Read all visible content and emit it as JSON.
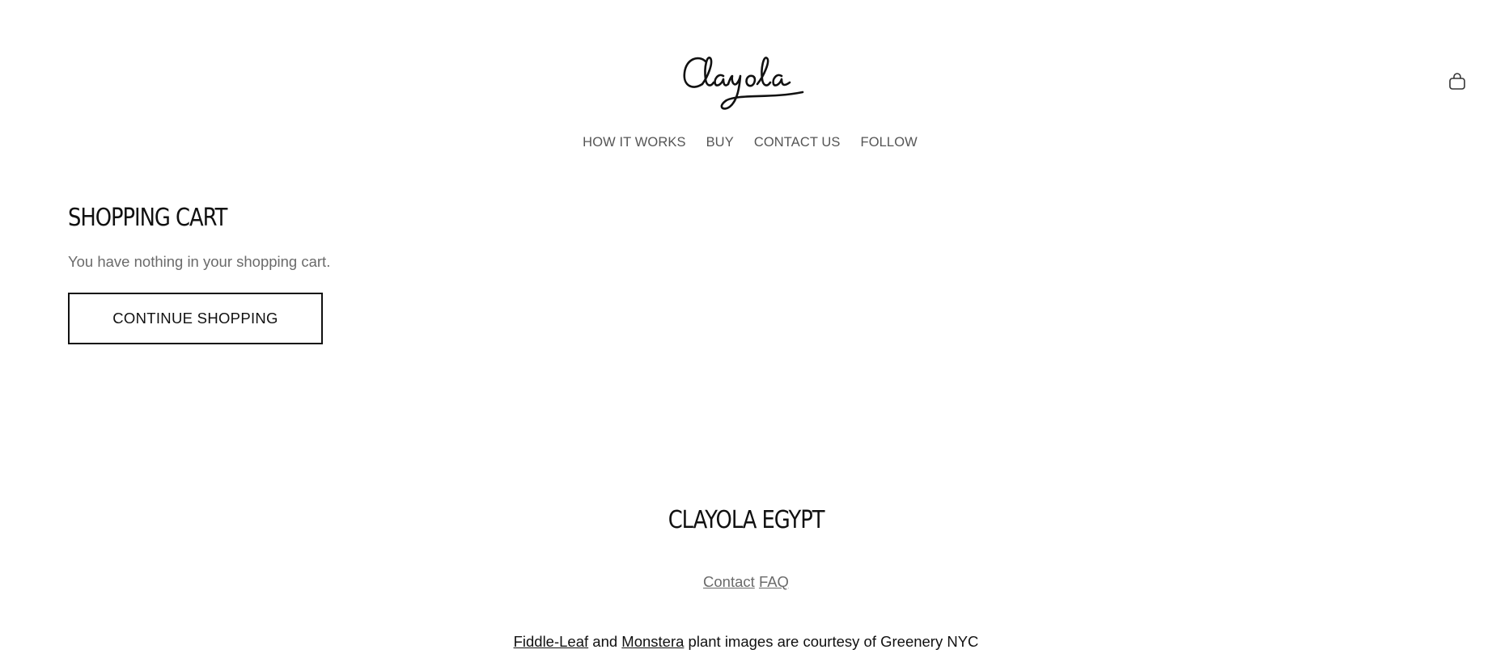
{
  "header": {
    "logo_text": "Clayola",
    "cart_icon": "shopping-bag-icon"
  },
  "nav": {
    "items": [
      {
        "label": "HOW IT WORKS"
      },
      {
        "label": "BUY"
      },
      {
        "label": "CONTACT US"
      },
      {
        "label": "FOLLOW"
      }
    ]
  },
  "cart": {
    "title": "SHOPPING CART",
    "empty_message": "You have nothing in your shopping cart.",
    "continue_label": "CONTINUE SHOPPING"
  },
  "footer": {
    "title": "CLAYOLA EGYPT",
    "links": [
      {
        "label": "Contact"
      },
      {
        "label": "FAQ"
      }
    ],
    "credits": {
      "link1": "Fiddle-Leaf",
      "and_text": " and ",
      "link2": "Monstera",
      "rest": " plant images are courtesy of Greenery NYC"
    }
  },
  "colors": {
    "text": "#111111",
    "muted": "#6b6b6b",
    "nav": "#555555",
    "background": "#ffffff"
  }
}
